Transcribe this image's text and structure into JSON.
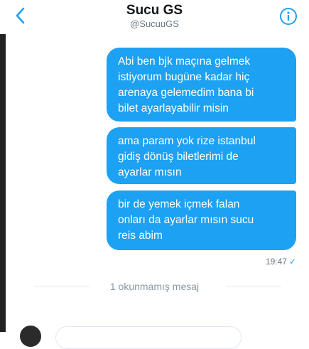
{
  "header": {
    "title": "Sucu GS",
    "handle": "@SucuuGS",
    "back_icon": "chevron-left-icon",
    "info_icon": "info-icon"
  },
  "messages": [
    {
      "text": "Abi ben bjk maçına gelmek\nistiyorum bugüne kadar hiç\narenaya gelemedim bana bi\nbilet ayarlayabilir misin"
    },
    {
      "text": "ama param yok rize istanbul\ngidiş dönüş biletlerimi de\nayarlar mısın"
    },
    {
      "text": "bir de yemek içmek falan\nonları da ayarlar mısın sucu\nreis abim"
    }
  ],
  "timestamp": "19:47",
  "read_mark": "✓",
  "unread_label": "1 okunmamış mesaj",
  "colors": {
    "accent": "#1da1f2",
    "secondary_text": "#657786"
  }
}
